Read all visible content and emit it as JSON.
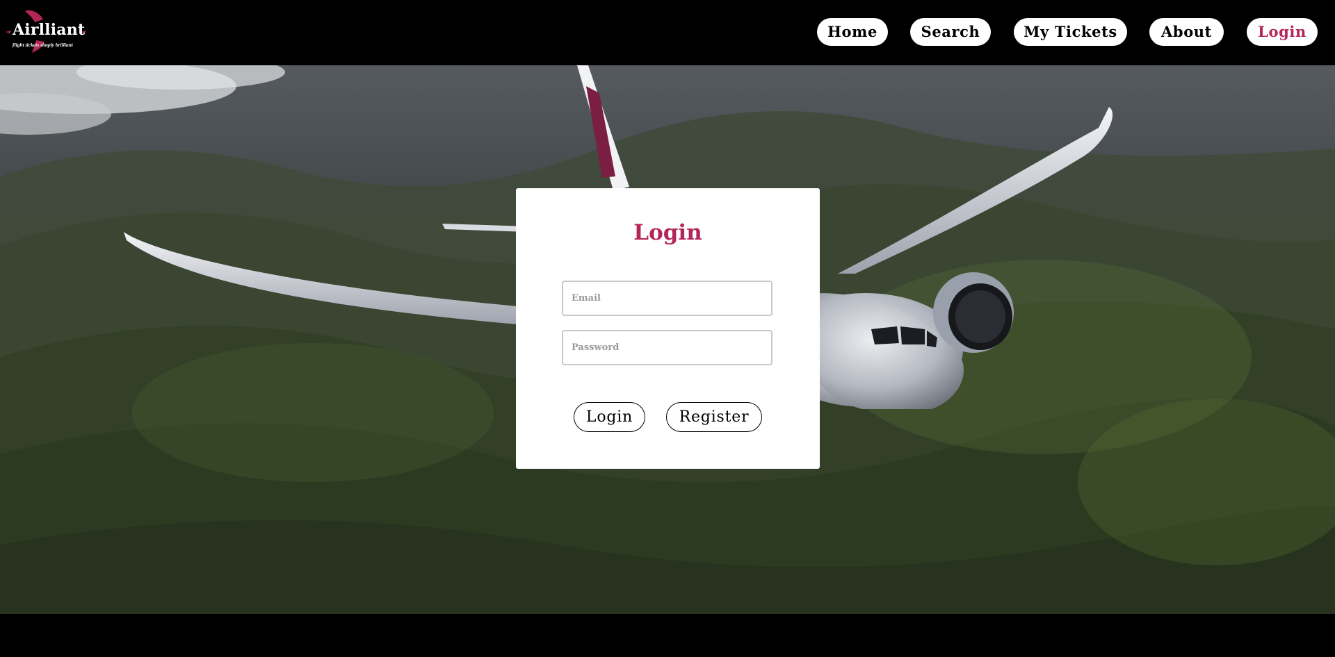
{
  "brand": {
    "name": "Airlliant",
    "tagline": "flight tickets simply brilliant",
    "accent_color": "#b3265a"
  },
  "nav": {
    "items": [
      {
        "label": "Home",
        "active": false
      },
      {
        "label": "Search",
        "active": false
      },
      {
        "label": "My Tickets",
        "active": false
      },
      {
        "label": "About",
        "active": false
      },
      {
        "label": "Login",
        "active": true
      }
    ]
  },
  "login_card": {
    "title": "Login",
    "email_placeholder": "Email",
    "password_placeholder": "Password",
    "login_button": "Login",
    "register_button": "Register"
  }
}
